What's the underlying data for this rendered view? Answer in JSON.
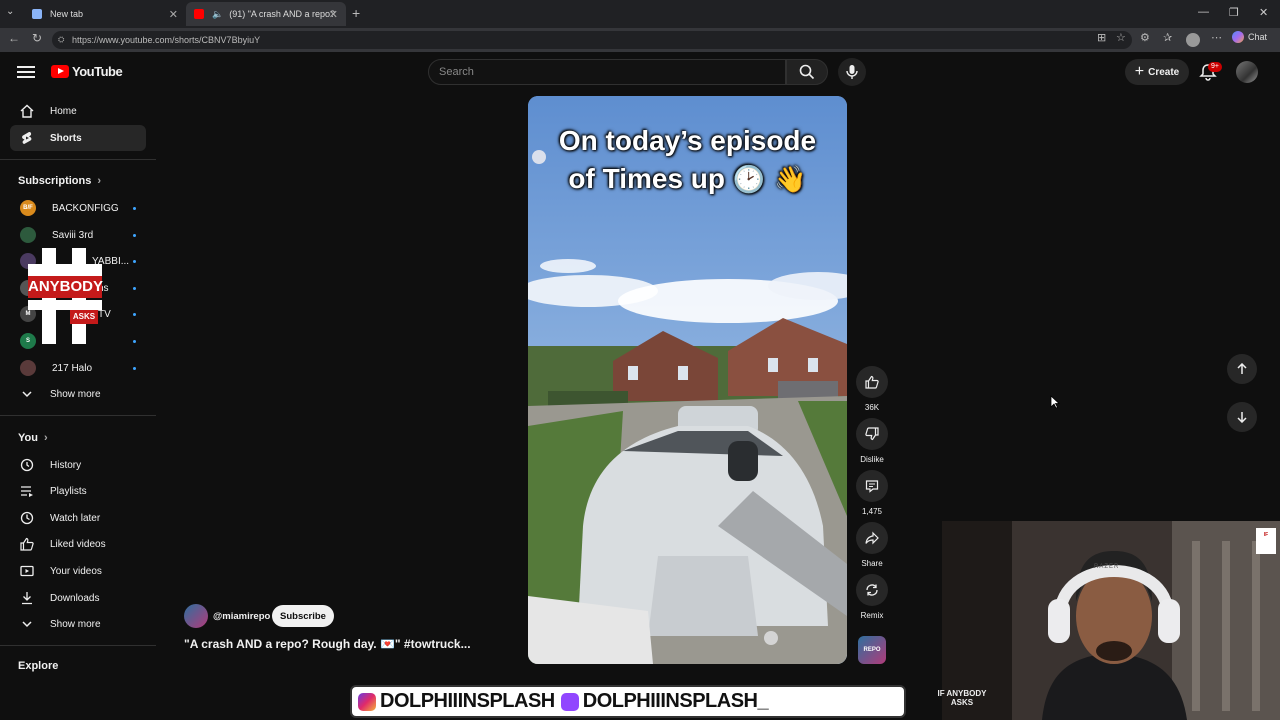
{
  "browser": {
    "tabs": [
      {
        "title": "New tab",
        "active": false
      },
      {
        "title": "(91) \"A crash AND a repo? Ro",
        "active": true
      }
    ],
    "url": "https://www.youtube.com/shorts/CBNV7BbyiuY",
    "chat_label": "Chat"
  },
  "masthead": {
    "logo_text": "YouTube",
    "search_placeholder": "Search",
    "create_label": "Create",
    "notification_badge": "9+"
  },
  "sidebar": {
    "main": [
      {
        "label": "Home",
        "icon": "home-icon",
        "active": false
      },
      {
        "label": "Shorts",
        "icon": "shorts-icon",
        "active": true
      }
    ],
    "subscriptions_heading": "Subscriptions",
    "subscriptions": [
      {
        "label": "BACKONFIGG",
        "color": "#d98a1c",
        "avatar_text": "B/F"
      },
      {
        "label": "Saviii 3rd",
        "color": "#2d5a3d",
        "avatar_text": ""
      },
      {
        "label": "YABBI...",
        "color": "#4a3a60",
        "avatar_text": ""
      },
      {
        "label": "ns",
        "color": "#555555",
        "avatar_text": ""
      },
      {
        "label": "TV",
        "color": "#444444",
        "avatar_text": "M"
      },
      {
        "label": "",
        "color": "#1e7a4a",
        "avatar_text": "S"
      },
      {
        "label": "217 Halo",
        "color": "#5a3a3a",
        "avatar_text": ""
      }
    ],
    "subs_show_more": "Show more",
    "you_heading": "You",
    "you_items": [
      {
        "label": "History",
        "icon": "history-icon"
      },
      {
        "label": "Playlists",
        "icon": "playlists-icon"
      },
      {
        "label": "Watch later",
        "icon": "watch-later-icon"
      },
      {
        "label": "Liked videos",
        "icon": "liked-videos-icon"
      },
      {
        "label": "Your videos",
        "icon": "your-videos-icon"
      },
      {
        "label": "Downloads",
        "icon": "downloads-icon"
      }
    ],
    "you_show_more": "Show more",
    "explore_heading": "Explore"
  },
  "overlay_logo": {
    "word1": "ANYBODY",
    "word2": "ASKS"
  },
  "short": {
    "caption_line1": "On today’s episode",
    "caption_line2": "of Times up",
    "caption_emoji": "🕑 👋",
    "channel": "@miamirepo",
    "subscribe_label": "Subscribe",
    "title": "\"A crash AND a repo? Rough day. 💌\" #towtruck...",
    "like_count": "36K",
    "dislike_label": "Dislike",
    "comment_count": "1,475",
    "share_label": "Share",
    "remix_label": "Remix",
    "sound_thumb_text": "REPO"
  },
  "stream": {
    "handle_instagram": "DOLPHIIINSPLASH",
    "handle_twitch": "DOLPHIIINSPLASH_",
    "watermark": "IF ANYBODY ASKS",
    "cam_brand": "RAZER"
  }
}
